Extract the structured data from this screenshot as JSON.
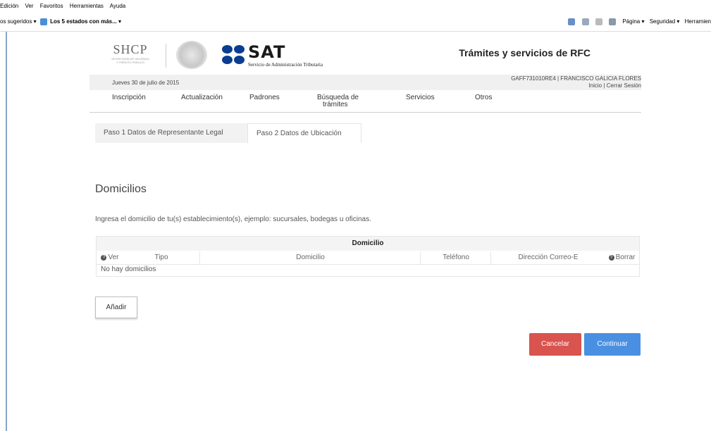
{
  "browser": {
    "menu": [
      "Edición",
      "Ver",
      "Favoritos",
      "Herramientas",
      "Ayuda"
    ],
    "favorites": {
      "suggested": "os sugeridos ▾",
      "bookmark": "Los 5 estados con más... ▾"
    },
    "toolbar": {
      "page": "Página ▾",
      "security": "Seguridad ▾",
      "tools": "Herramien"
    }
  },
  "header": {
    "shcp_title": "SHCP",
    "shcp_sub1": "SECRETARÍA DE HACIENDA",
    "shcp_sub2": "Y CRÉDITO PÚBLICO",
    "sat_word": "SAT",
    "sat_sub": "Servicio de Administración Tributaria",
    "page_title": "Trámites y servicios de RFC"
  },
  "infobar": {
    "date": "Jueves 30 de julio de 2015",
    "user": "GAFF731010RE4 | FRANCISCO GALICIA FLORES",
    "home_link": "Inicio",
    "separator": " | ",
    "logout_link": "Cerrar Sesión"
  },
  "nav": {
    "items": [
      {
        "label": "Inscripción"
      },
      {
        "label": "Actualización"
      },
      {
        "label": "Padrones"
      },
      {
        "label": "Búsqueda de"
      },
      {
        "label": "Servicios"
      },
      {
        "label": "Otros"
      }
    ],
    "busqueda_line2": "trámites"
  },
  "tabs": [
    {
      "label": "Paso 1 Datos de Representante Legal",
      "active": false
    },
    {
      "label": "Paso 2 Datos de Ubicación",
      "active": true
    }
  ],
  "content": {
    "section_title": "Domicilios",
    "intro": "Ingresa el domicilio de tu(s) establecimiento(s), ejemplo: sucursales, bodegas u oficinas.",
    "table": {
      "caption": "Domicilio",
      "columns": [
        "Ver",
        "Tipo",
        "Domicilio",
        "Teléfono",
        "Dirección Correo-E",
        "Borrar"
      ],
      "empty_message": "No hay domicilios"
    },
    "add_button": "Añadir",
    "cancel_button": "Cancelar",
    "continue_button": "Continuar"
  },
  "colors": {
    "cancel": "#d9534f",
    "continue": "#4a90e2",
    "sat_blue": "#0a3d8f"
  }
}
